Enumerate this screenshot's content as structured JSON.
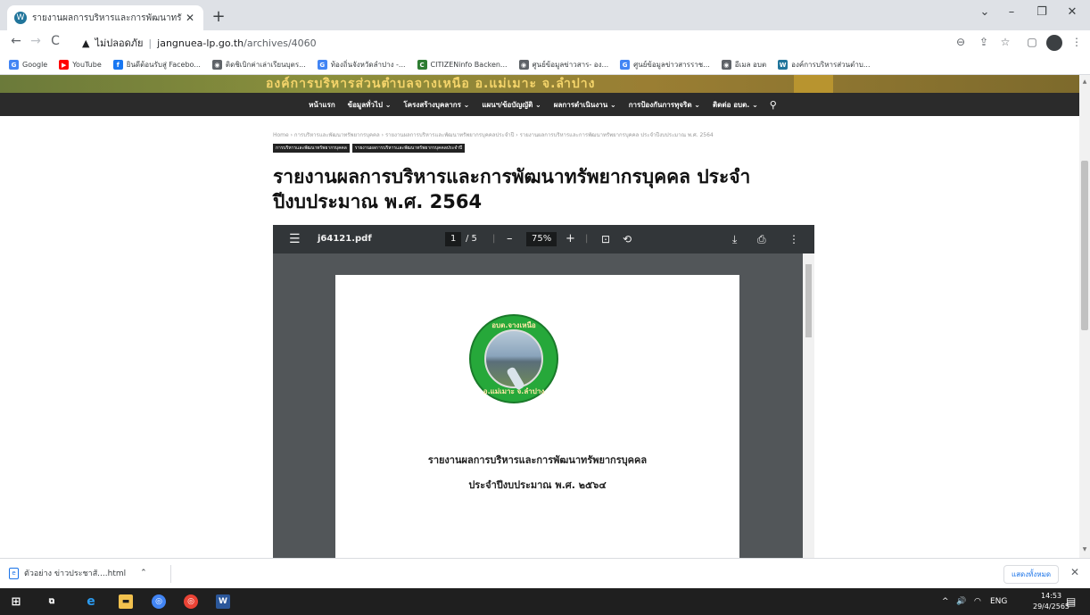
{
  "browser": {
    "tab_title": "รายงานผลการบริหารและการพัฒนาทรั",
    "url_security": "ไม่ปลอดภัย",
    "url_host": "jangnuea-lp.go.th",
    "url_path": "/archives/4060"
  },
  "bookmarks": [
    {
      "label": "Google",
      "icon": "google-icon",
      "color": "#4285f4",
      "glyph": "G"
    },
    {
      "label": "YouTube",
      "icon": "youtube-icon",
      "color": "#ff0000",
      "glyph": "▶"
    },
    {
      "label": "ยินดีต้อนรับสู่ Facebo...",
      "icon": "facebook-icon",
      "color": "#1877f2",
      "glyph": "f"
    },
    {
      "label": "ติดชิเบิกค่าเล่าเรียนบุตร...",
      "icon": "globe-icon",
      "color": "#5f6368",
      "glyph": "◉"
    },
    {
      "label": "ท้องถิ่นจังหวัดลำปาง -...",
      "icon": "google-icon",
      "color": "#4285f4",
      "glyph": "G"
    },
    {
      "label": "CITIZENinfo Backen...",
      "icon": "citizen-icon",
      "color": "#2e7d32",
      "glyph": "C"
    },
    {
      "label": "ศูนย์ข้อมูลข่าวสาร- อง...",
      "icon": "globe-icon",
      "color": "#5f6368",
      "glyph": "◉"
    },
    {
      "label": "ศูนย์ข้อมูลข่าวสารราช...",
      "icon": "google-icon",
      "color": "#4285f4",
      "glyph": "G"
    },
    {
      "label": "อีเมล อบต",
      "icon": "globe-icon",
      "color": "#5f6368",
      "glyph": "◉"
    },
    {
      "label": "องค์การบริหารส่วนตำบ...",
      "icon": "wordpress-icon",
      "color": "#21759b",
      "glyph": "W"
    }
  ],
  "site": {
    "banner_text": "องค์การบริหารส่วนตำบลจางเหนือ อ.แม่เมาะ จ.ลำปาง",
    "menu": [
      {
        "label": "หน้าแรก"
      },
      {
        "label": "ข้อมูลทั่วไป ⌄"
      },
      {
        "label": "โครงสร้างบุคลากร ⌄"
      },
      {
        "label": "แผนฯ/ข้อบัญญัติ ⌄"
      },
      {
        "label": "ผลการดำเนินงาน ⌄"
      },
      {
        "label": "การป้องกันการทุจริต ⌄"
      },
      {
        "label": "ติดต่อ อบต. ⌄"
      }
    ],
    "breadcrumb": "Home  ›  การบริหารและพัฒนาทรัพยากรบุคคล  ›  รายงานผลการบริหารและพัฒนาทรัพยากรบุคคลประจำปี  ›  รายงานผลการบริหารและการพัฒนาทรัพยากรบุคคล ประจำปีงบประมาณ พ.ศ. 2564",
    "categories": [
      "การบริหารและพัฒนาทรัพยากรบุคคล",
      "รายงานผลการบริหารและพัฒนาทรัพยากรบุคคลประจำปี"
    ],
    "post_title": "รายงานผลการบริหารและการพัฒนาทรัพยากรบุคคล ประจำปีงบประมาณ พ.ศ. 2564"
  },
  "pdf": {
    "filename": "j64121.pdf",
    "page_current": "1",
    "page_total": "/ 5",
    "zoom": "75%",
    "seal_top": "อบต.จางเหนือ",
    "seal_bottom": "อ.แม่เมาะ จ.ลำปาง",
    "doc_line1": "รายงานผลการบริหารและการพัฒนาทรัพยากรบุคคล",
    "doc_line2": "ประจำปีงบประมาณ พ.ศ. ๒๕๖๔"
  },
  "downloads": {
    "file": "ตัวอย่าง ข่าวประชาสั....html",
    "show_all": "แสดงทั้งหมด"
  },
  "taskbar": {
    "lang": "ENG",
    "time": "14:53",
    "date": "29/4/2565"
  }
}
